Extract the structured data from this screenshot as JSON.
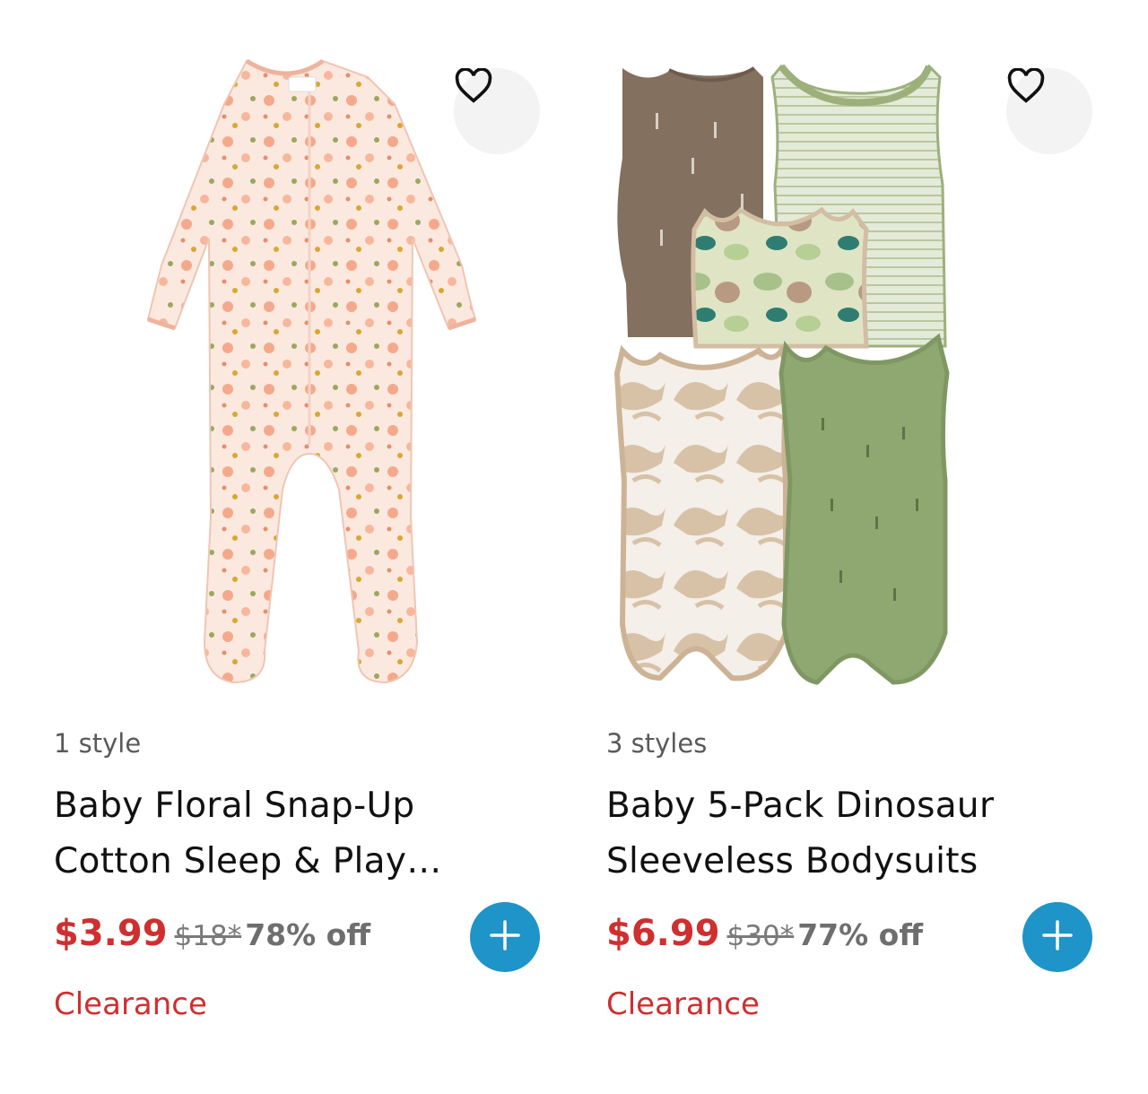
{
  "products": [
    {
      "styles": "1 style",
      "title_line1": "Baby Floral Snap-Up",
      "title_line2": "Cotton Sleep & Play…",
      "sale_price": "$3.99",
      "original_price": "$18*",
      "discount": "78% off",
      "badge": "Clearance"
    },
    {
      "styles": "3 styles",
      "title_line1": "Baby 5-Pack Dinosaur",
      "title_line2": "Sleeveless Bodysuits",
      "sale_price": "$6.99",
      "original_price": "$30*",
      "discount": "77% off",
      "badge": "Clearance"
    }
  ],
  "icons": {
    "favorite": "heart-outline-icon",
    "add": "plus-icon"
  },
  "colors": {
    "sale": "#cf2f2f",
    "add_button": "#1e94c8",
    "favorite_bg": "#f3f3f3"
  }
}
